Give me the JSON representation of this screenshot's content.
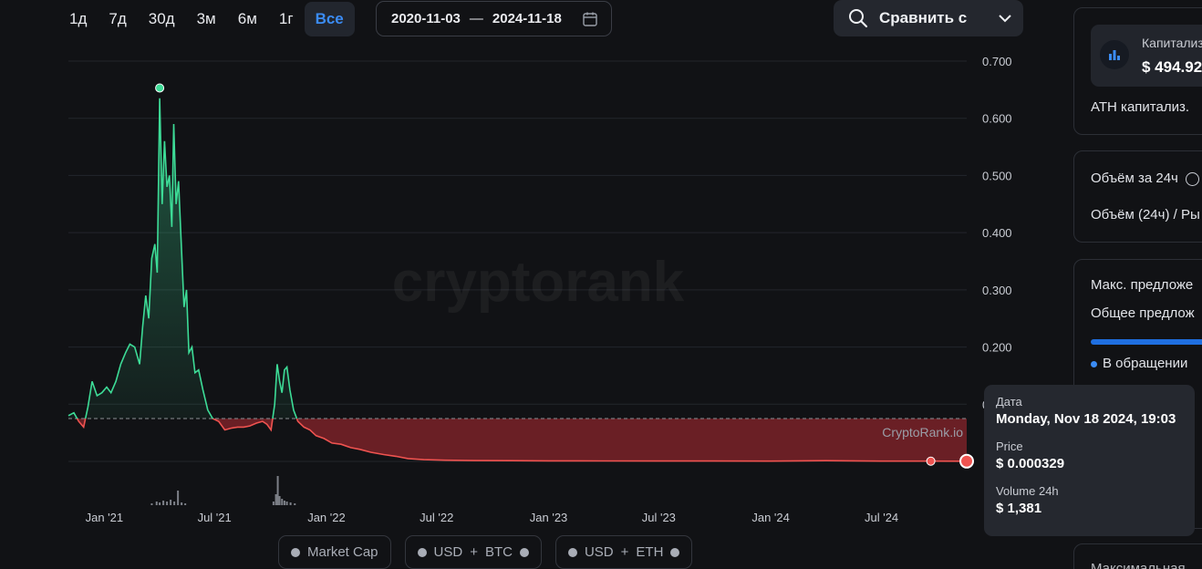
{
  "timeframes": [
    {
      "label": "1д",
      "active": false
    },
    {
      "label": "7д",
      "active": false
    },
    {
      "label": "30д",
      "active": false
    },
    {
      "label": "3м",
      "active": false
    },
    {
      "label": "6м",
      "active": false
    },
    {
      "label": "1г",
      "active": false
    },
    {
      "label": "Все",
      "active": true
    }
  ],
  "date_range": {
    "start": "2020-11-03",
    "separator": "—",
    "end": "2024-11-18"
  },
  "compare": {
    "label": "Сравнить с"
  },
  "legend_buttons": {
    "market_cap": "Market Cap",
    "usd": "USD",
    "btc": "BTC",
    "usd2": "USD",
    "eth": "ETH",
    "plus": "+"
  },
  "tooltip": {
    "date_label": "Дата",
    "date_value": "Monday, Nov 18 2024, 19:03",
    "price_label": "Price",
    "price_value": "$ 0.000329",
    "volume_label": "Volume 24h",
    "volume_value": "$ 1,381"
  },
  "sidebar": {
    "cap_label": "Капитализ",
    "cap_value": "$ 494.92",
    "ath_label": "ATH капитализ.",
    "volume_24h_label": "Объём за 24ч",
    "volume_ratio_label": "Объём (24ч) / Ры",
    "max_supply_label": "Макс. предложе",
    "total_supply_label": "Общее предлож",
    "circulating_label": "В обращении",
    "bottom_label": "Максимальная"
  },
  "colors": {
    "up": "#3ddc97",
    "down": "#ef5350",
    "accent": "#3b8cf5"
  },
  "chart_data": {
    "type": "area",
    "watermark": "cryptorank",
    "source_label": "CryptoRank.io",
    "y_ticks": [
      "0.700",
      "0.600",
      "0.500",
      "0.400",
      "0.300",
      "0.200",
      "0.100",
      "0"
    ],
    "ylim": [
      0,
      0.7
    ],
    "x_ticks": [
      "Jan '21",
      "Jul '21",
      "Jan '22",
      "Jul '22",
      "Jan '23",
      "Jul '23",
      "Jan '24",
      "Jul '24"
    ],
    "baseline": 0.075,
    "points": [
      [
        "2020-11-03",
        0.08
      ],
      [
        "2020-11-12",
        0.085
      ],
      [
        "2020-11-20",
        0.07
      ],
      [
        "2020-11-28",
        0.06
      ],
      [
        "2020-12-05",
        0.095
      ],
      [
        "2020-12-12",
        0.14
      ],
      [
        "2020-12-20",
        0.115
      ],
      [
        "2020-12-28",
        0.12
      ],
      [
        "2021-01-05",
        0.13
      ],
      [
        "2021-01-12",
        0.12
      ],
      [
        "2021-01-20",
        0.14
      ],
      [
        "2021-01-28",
        0.17
      ],
      [
        "2021-02-05",
        0.19
      ],
      [
        "2021-02-12",
        0.205
      ],
      [
        "2021-02-20",
        0.2
      ],
      [
        "2021-02-28",
        0.17
      ],
      [
        "2021-03-05",
        0.235
      ],
      [
        "2021-03-10",
        0.29
      ],
      [
        "2021-03-15",
        0.25
      ],
      [
        "2021-03-20",
        0.355
      ],
      [
        "2021-03-25",
        0.38
      ],
      [
        "2021-03-29",
        0.33
      ],
      [
        "2021-04-02",
        0.635
      ],
      [
        "2021-04-06",
        0.45
      ],
      [
        "2021-04-10",
        0.56
      ],
      [
        "2021-04-14",
        0.48
      ],
      [
        "2021-04-18",
        0.5
      ],
      [
        "2021-04-22",
        0.41
      ],
      [
        "2021-04-25",
        0.59
      ],
      [
        "2021-04-29",
        0.45
      ],
      [
        "2021-05-03",
        0.49
      ],
      [
        "2021-05-07",
        0.39
      ],
      [
        "2021-05-12",
        0.27
      ],
      [
        "2021-05-16",
        0.3
      ],
      [
        "2021-05-20",
        0.19
      ],
      [
        "2021-05-25",
        0.2
      ],
      [
        "2021-05-30",
        0.155
      ],
      [
        "2021-06-05",
        0.16
      ],
      [
        "2021-06-12",
        0.125
      ],
      [
        "2021-06-20",
        0.09
      ],
      [
        "2021-06-28",
        0.075
      ],
      [
        "2021-07-08",
        0.07
      ],
      [
        "2021-07-18",
        0.055
      ],
      [
        "2021-07-28",
        0.058
      ],
      [
        "2021-08-08",
        0.06
      ],
      [
        "2021-08-18",
        0.06
      ],
      [
        "2021-08-28",
        0.062
      ],
      [
        "2021-09-08",
        0.067
      ],
      [
        "2021-09-18",
        0.07
      ],
      [
        "2021-09-25",
        0.065
      ],
      [
        "2021-10-02",
        0.055
      ],
      [
        "2021-10-08",
        0.1
      ],
      [
        "2021-10-12",
        0.17
      ],
      [
        "2021-10-16",
        0.14
      ],
      [
        "2021-10-20",
        0.12
      ],
      [
        "2021-10-24",
        0.16
      ],
      [
        "2021-10-28",
        0.165
      ],
      [
        "2021-11-02",
        0.125
      ],
      [
        "2021-11-08",
        0.09
      ],
      [
        "2021-11-15",
        0.07
      ],
      [
        "2021-11-25",
        0.06
      ],
      [
        "2021-12-05",
        0.055
      ],
      [
        "2021-12-15",
        0.045
      ],
      [
        "2021-12-28",
        0.04
      ],
      [
        "2022-01-10",
        0.032
      ],
      [
        "2022-01-25",
        0.03
      ],
      [
        "2022-02-10",
        0.024
      ],
      [
        "2022-02-25",
        0.021
      ],
      [
        "2022-03-15",
        0.016
      ],
      [
        "2022-04-05",
        0.012
      ],
      [
        "2022-04-25",
        0.009
      ],
      [
        "2022-05-15",
        0.005
      ],
      [
        "2022-06-10",
        0.003
      ],
      [
        "2022-07-15",
        0.002
      ],
      [
        "2022-09-01",
        0.0015
      ],
      [
        "2022-11-01",
        0.0012
      ],
      [
        "2023-01-01",
        0.001
      ],
      [
        "2023-04-01",
        0.0008
      ],
      [
        "2023-07-01",
        0.0007
      ],
      [
        "2023-10-01",
        0.0006
      ],
      [
        "2024-01-01",
        0.0005
      ],
      [
        "2024-04-01",
        0.0012
      ],
      [
        "2024-07-01",
        0.0004
      ],
      [
        "2024-09-20",
        0.0004
      ],
      [
        "2024-11-18",
        0.000329
      ]
    ],
    "ath_point": [
      "2021-04-02",
      0.653
    ],
    "highlight_point": [
      "2024-09-20",
      0.0004
    ],
    "current_point": [
      "2024-11-18",
      0.000329
    ],
    "volume_bars": [
      [
        "2021-03-20",
        2
      ],
      [
        "2021-03-28",
        4
      ],
      [
        "2021-04-02",
        3
      ],
      [
        "2021-04-08",
        5
      ],
      [
        "2021-04-14",
        4
      ],
      [
        "2021-04-20",
        6
      ],
      [
        "2021-04-26",
        4
      ],
      [
        "2021-05-02",
        16
      ],
      [
        "2021-05-08",
        3
      ],
      [
        "2021-05-14",
        2
      ],
      [
        "2021-10-06",
        4
      ],
      [
        "2021-10-10",
        12
      ],
      [
        "2021-10-13",
        32
      ],
      [
        "2021-10-16",
        10
      ],
      [
        "2021-10-20",
        7
      ],
      [
        "2021-10-24",
        5
      ],
      [
        "2021-10-28",
        4
      ],
      [
        "2021-11-03",
        3
      ],
      [
        "2021-11-10",
        2
      ]
    ]
  }
}
